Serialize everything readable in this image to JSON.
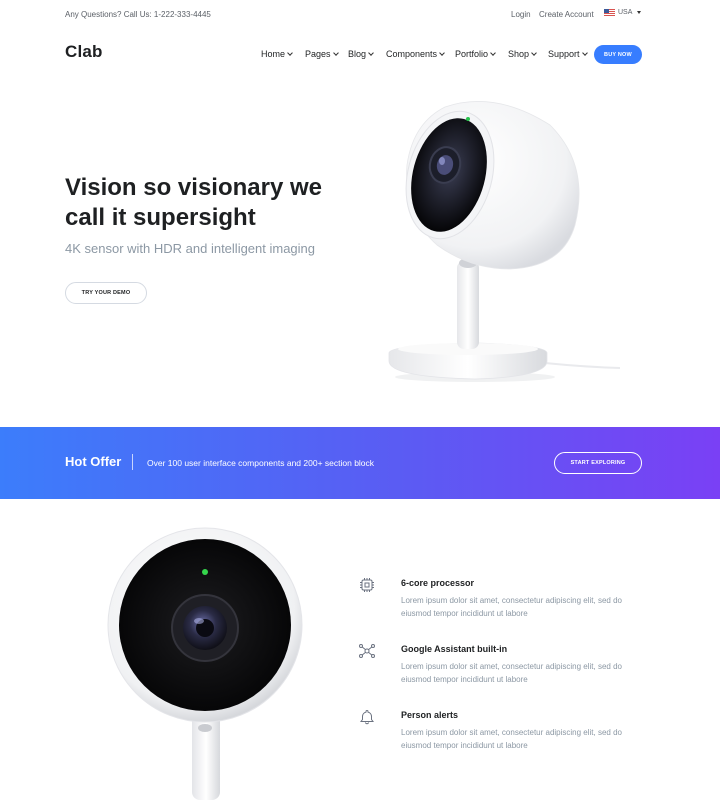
{
  "topbar": {
    "contact": "Any Questions? Call Us: 1-222-333-4445",
    "login": "Login",
    "create_account": "Create Account",
    "language": "USA"
  },
  "brand": {
    "logo": "Clab"
  },
  "nav": {
    "items": [
      "Home",
      "Pages",
      "Blog",
      "Components",
      "Portfolio",
      "Shop",
      "Support"
    ],
    "buy_now": "BUY NOW"
  },
  "hero": {
    "title": "Vision so visionary we call it supersight",
    "subtitle": "4K sensor with HDR and intelligent imaging",
    "cta": "TRY YOUR DEMO"
  },
  "offer": {
    "title": "Hot Offer",
    "text": "Over 100 user interface components and 200+ section block",
    "cta": "START EXPLORING"
  },
  "features": [
    {
      "icon": "processor-icon",
      "title": "6-core processor",
      "description": "Lorem ipsum dolor sit amet, consectetur adipiscing elit, sed do eiusmod tempor incididunt ut labore"
    },
    {
      "icon": "network-nodes-icon",
      "title": "Google Assistant built-in",
      "description": "Lorem ipsum dolor sit amet, consectetur adipiscing elit, sed do eiusmod tempor incididunt ut labore"
    },
    {
      "icon": "bell-icon",
      "title": "Person alerts",
      "description": "Lorem ipsum dolor sit amet, consectetur adipiscing elit, sed do eiusmod tempor incididunt ut labore"
    }
  ],
  "colors": {
    "primary": "#377dff",
    "gradient_start": "#3c7dfb",
    "gradient_end": "#7a40f5",
    "text_dark": "#1e2022",
    "text_muted": "#8c98a4"
  }
}
